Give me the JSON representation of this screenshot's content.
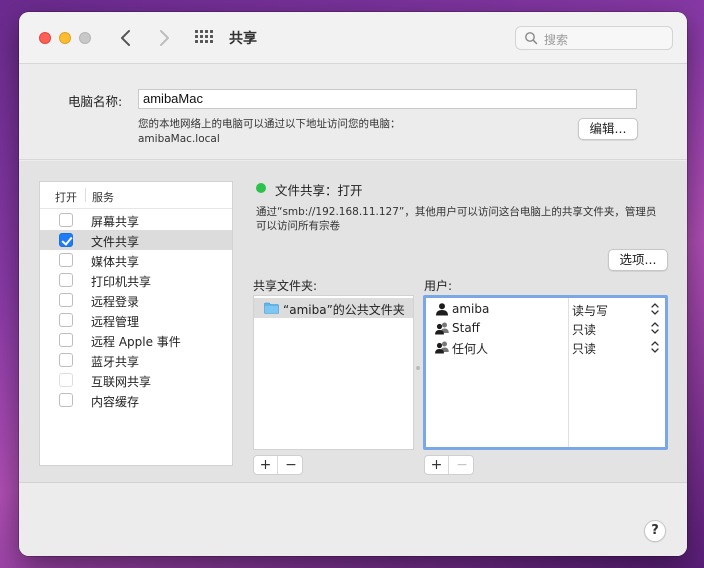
{
  "window": {
    "title": "共享"
  },
  "search": {
    "placeholder": "搜索"
  },
  "computer": {
    "name_label": "电脑名称:",
    "name_value": "amibaMac",
    "hint_line1": "您的本地网络上的电脑可以通过以下地址访问您的电脑：",
    "hint_line2": "amibaMac.local",
    "edit_button": "编辑..."
  },
  "services": {
    "header_on": "打开",
    "header_service": "服务",
    "items": [
      {
        "label": "屏幕共享",
        "checked": false,
        "selected": false
      },
      {
        "label": "文件共享",
        "checked": true,
        "selected": true
      },
      {
        "label": "媒体共享",
        "checked": false,
        "selected": false
      },
      {
        "label": "打印机共享",
        "checked": false,
        "selected": false
      },
      {
        "label": "远程登录",
        "checked": false,
        "selected": false
      },
      {
        "label": "远程管理",
        "checked": false,
        "selected": false
      },
      {
        "label": "远程 Apple 事件",
        "checked": false,
        "selected": false
      },
      {
        "label": "蓝牙共享",
        "checked": false,
        "selected": false
      },
      {
        "label": "互联网共享",
        "checked": false,
        "selected": false,
        "disabled": true
      },
      {
        "label": "内容缓存",
        "checked": false,
        "selected": false
      }
    ]
  },
  "detail": {
    "status_title": "文件共享：打开",
    "status_color": "#2cc24b",
    "description": "通过“smb://192.168.11.127”，其他用户可以访问这台电脑上的共享文件夹，管理员可以访问所有宗卷",
    "options_button": "选项..."
  },
  "shared_folders": {
    "label": "共享文件夹:",
    "items": [
      {
        "name": "“amiba”的公共文件夹",
        "icon": "folder-icon"
      }
    ]
  },
  "users": {
    "label": "用户:",
    "items": [
      {
        "name": "amiba",
        "permission": "读与写",
        "icon": "single-user-icon"
      },
      {
        "name": "Staff",
        "permission": "只读",
        "icon": "group-icon"
      },
      {
        "name": "任何人",
        "permission": "只读",
        "icon": "group-icon"
      }
    ]
  },
  "controls": {
    "plus": "+",
    "minus": "−"
  },
  "help": {
    "label": "?"
  }
}
